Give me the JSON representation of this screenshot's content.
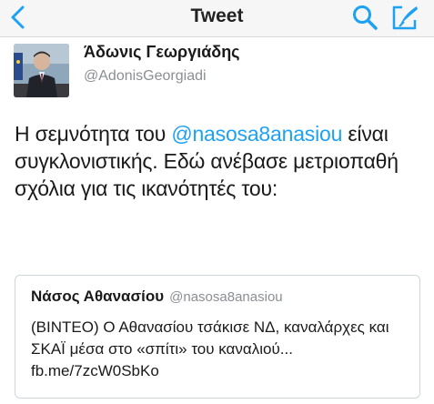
{
  "navbar": {
    "title": "Tweet",
    "back_icon": "chevron-left-icon",
    "search_icon": "search-icon",
    "compose_icon": "compose-icon"
  },
  "tweet": {
    "author_name": "Άδωνις Γεωργιάδης",
    "author_handle": "@AdonisGeorgiadi",
    "text_before": "Η σεμνότητα του ",
    "mention": "@nasosa8anasiou",
    "text_after": " είναι συγκλονιστικής. Εδώ ανέβασε μετριοπαθή σχόλια για τις ικανότητές του:"
  },
  "quote": {
    "name": "Νάσος Αθανασίου",
    "handle": "@nasosa8anasiou",
    "text": "(ΒΙΝΤΕΟ) Ο Αθανασίου τσάκισε ΝΔ, καναλάρχες και ΣΚΑΪ μέσα στο «σπίτι» του καναλιού... fb.me/7zcW0SbKo"
  },
  "colors": {
    "accent": "#1da1f2",
    "handle_gray": "#8a8f94",
    "navbar_bg": "#f6f6f6"
  }
}
